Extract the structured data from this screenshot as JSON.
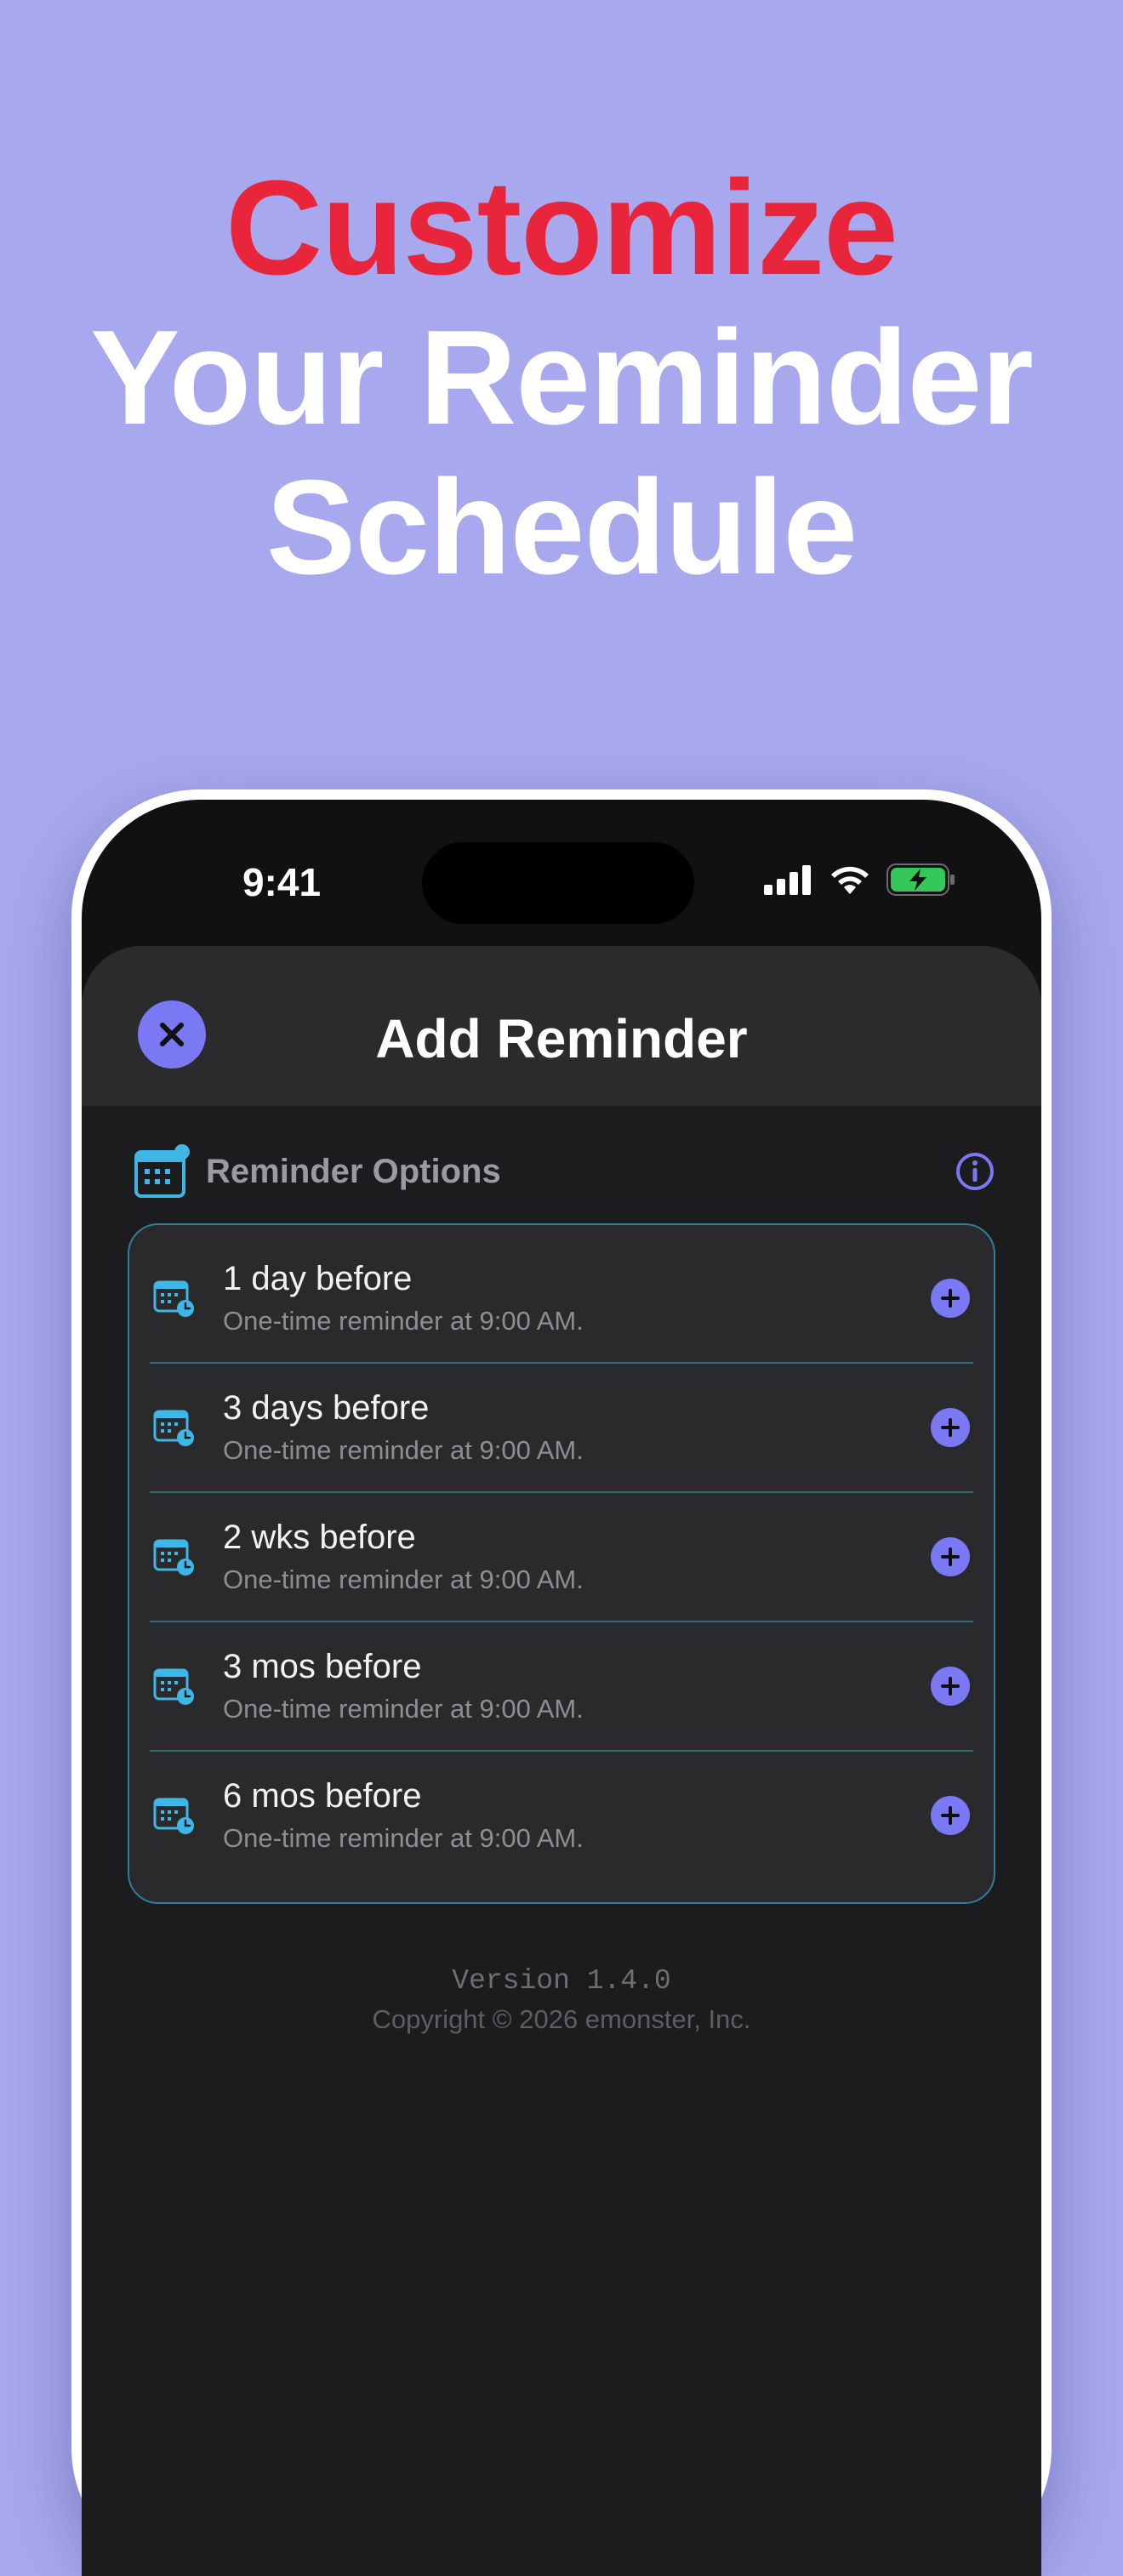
{
  "headline": {
    "line1": "Customize",
    "line2": "Your Reminder",
    "line3": "Schedule"
  },
  "status_bar": {
    "time": "9:41",
    "icons": [
      "cellular-signal-icon",
      "wifi-icon",
      "battery-charging-icon"
    ]
  },
  "sheet": {
    "title": "Add Reminder",
    "close_icon": "close-icon"
  },
  "section": {
    "label": "Reminder Options",
    "icon": "calendar-clock-icon",
    "info_icon": "info-icon"
  },
  "options": [
    {
      "title": "1 day before",
      "subtitle": "One-time reminder at 9:00 AM."
    },
    {
      "title": "3 days before",
      "subtitle": "One-time reminder at 9:00 AM."
    },
    {
      "title": "2 wks before",
      "subtitle": "One-time reminder at 9:00 AM."
    },
    {
      "title": "3 mos before",
      "subtitle": "One-time reminder at 9:00 AM."
    },
    {
      "title": "6 mos before",
      "subtitle": "One-time reminder at 9:00 AM."
    }
  ],
  "footer": {
    "version": "Version 1.4.0",
    "copyright": "Copyright © 2026 emonster, Inc."
  },
  "colors": {
    "background": "#a8a8ee",
    "headline_accent": "#e8253a",
    "button_accent": "#7a78f3",
    "icon_accent": "#3fb6e6",
    "card_border": "#2f7e98",
    "battery_green": "#34c759"
  }
}
